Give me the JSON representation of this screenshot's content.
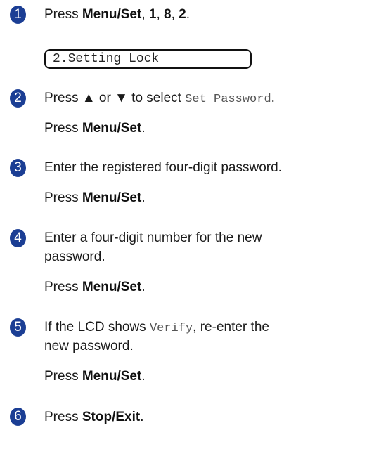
{
  "steps": [
    {
      "number": "1",
      "text": {
        "p1": "Press ",
        "b1": "Menu/Set",
        "p2": ", ",
        "b2": "1",
        "p3": ", ",
        "b3": "8",
        "p4": ", ",
        "b4": "2",
        "p5": "."
      },
      "lcd": "2.Setting Lock"
    },
    {
      "number": "2",
      "line1": {
        "p1": "Press ▲ or ▼ to select ",
        "mono": "Set Password",
        "p2": "."
      },
      "line2": {
        "p1": "Press ",
        "b1": "Menu/Set",
        "p2": "."
      }
    },
    {
      "number": "3",
      "line1": "Enter the registered four-digit password.",
      "line2": {
        "p1": "Press ",
        "b1": "Menu/Set",
        "p2": "."
      }
    },
    {
      "number": "4",
      "line1": "Enter a four-digit number for the new",
      "line1b": "password.",
      "line2": {
        "p1": "Press ",
        "b1": "Menu/Set",
        "p2": "."
      }
    },
    {
      "number": "5",
      "line1": {
        "p1": "If the LCD shows ",
        "mono": "Verify",
        "p2": ", re-enter the"
      },
      "line1b": "new password.",
      "line2": {
        "p1": "Press ",
        "b1": "Menu/Set",
        "p2": "."
      }
    },
    {
      "number": "6",
      "line1": {
        "p1": "Press ",
        "b1": "Stop/Exit",
        "p2": "."
      }
    }
  ],
  "colors": {
    "badge": "#1b3e94",
    "text": "#1a1a1a",
    "mono": "#555555"
  }
}
